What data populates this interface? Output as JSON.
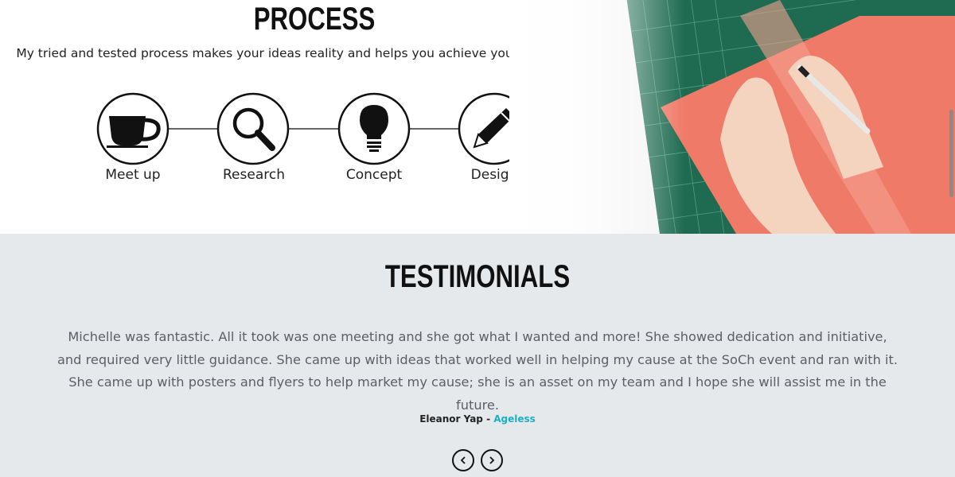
{
  "process": {
    "title": "PROCESS",
    "subtitle": "My tried and tested process makes your ideas reality and helps you achieve your business goals",
    "steps": [
      {
        "label": "Meet up",
        "icon": "coffee-cup-icon"
      },
      {
        "label": "Research",
        "icon": "magnifier-icon"
      },
      {
        "label": "Concept",
        "icon": "lightbulb-icon"
      },
      {
        "label": "Design",
        "icon": "pencil-icon"
      }
    ]
  },
  "testimonials": {
    "title": "TESTIMONIALS",
    "quote": "Michelle was fantastic. All it took was one meeting and she got what I wanted and more! She showed dedication and initiative, and required very little guidance. She came up with ideas that worked well in helping my cause at the SoCh event and ran with it. She came up with posters and flyers to help market my cause; she is an asset on my team and I hope she will assist me in the future.",
    "author": "Eleanor Yap",
    "separator": " - ",
    "organization": "Ageless",
    "prev_icon": "chevron-left-icon",
    "next_icon": "chevron-right-icon"
  },
  "colors": {
    "accent": "#1ab0c8",
    "testimonials_bg": "#e6e9ec",
    "cutting_mat": "#1f6b52",
    "paper": "#f07a68"
  }
}
